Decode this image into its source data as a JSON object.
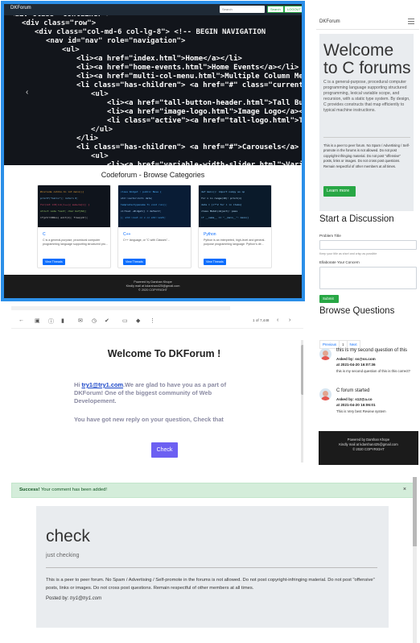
{
  "forum_window": {
    "brand": "DKForum",
    "search_placeholder": "Search",
    "search_button": "Search",
    "login_button": "LOGOUT",
    "section_title": "Codeforum - Browse Categories",
    "categories": [
      {
        "title": "C",
        "desc": "C is a general-purpose, procedural computer programming language supporting structured pro...",
        "button": "View Threads"
      },
      {
        "title": "C++",
        "desc": "C++ language, or \"C with Classes\"...",
        "button": "View Threads"
      },
      {
        "title": "Python",
        "desc": "Python is an interpreted, high-level and general-purpose programming language. Python's de...",
        "button": "View Threads"
      }
    ],
    "footer_line1": "Powered by Darshan Khope",
    "footer_line2": "Kindly mail at kdarshan425@gmail.com",
    "footer_line3": "© 2020 COPYRIGHT",
    "code_lines": [
      "<div class=\"container\">",
      "<div class=\"row\">",
      "<div class=\"col-md-6 col-lg-8\"> <!-- BEGIN NAVIGATION",
      "<nav id=\"nav\" role=\"navigation\">",
      "<ul>",
      "<li><a href=\"index.html\">Home</a></li>",
      "<li><a href=\"home-events.html\">Home Events</a></li>",
      "<li><a href=\"multi-col-menu.html\">Multiple Column Men",
      "<li class=\"has-children\"> <a href=\"#\" class=\"current\"",
      "<ul>",
      "<li><a href=\"tall-button-header.html\">Tall But",
      "<li><a href=\"image-logo.html\">Image Logo</a></",
      "<li class=\"active\"><a href=\"tall-logo.html\">T",
      "</ul>",
      "</li>",
      "<li class=\"has-children\"> <a href=\"#\">Carousels</a>",
      "<ul>",
      "<li><a href=\"variable-width-slider.html\">Variab",
      "<li><a href=\"testimonial-slider.html\">Testimonia"
    ]
  },
  "side_window": {
    "brand": "DKForum",
    "jumbo_title": "Welcome to C forums",
    "jumbo_lead": "C is a general-purpose, procedural computer programming language supporting structured programming, lexical variable scope, and recursion, with a static type system. By design, C provides constructs that map efficiently to typical machine instructions.",
    "jumbo_rules": "This is a peer to peer forum. No Spam / Advertising / Self-promote in the forums is not allowed. Do not post copyright-infringing material. Do not post \"offensive\" posts, links or images. Do not cross post questions. Remain respectful of other members at all times.",
    "learn_more": "Learn more",
    "start_title": "Start a Discussion",
    "problem_label": "Problem Title",
    "problem_hint": "Keep your title as short and crisp as possible",
    "concern_label": "Ellaborate Your Concern",
    "submit": "Submit",
    "browse_title": "Browse Questions",
    "pager": [
      "Previous",
      "1",
      "Next"
    ],
    "questions": [
      {
        "title": "this is my second question of this",
        "asked_prefix": "Asked by: ",
        "asked_by": "ss@ss.com",
        "asked_at": "at 2021-04-20 16:07:36",
        "desc": "this is my second question of this is this correct?"
      },
      {
        "title": "C forum started",
        "asked_prefix": "Asked by: ",
        "asked_by": "s12@a.co",
        "asked_at": "at 2021-04-20 16:06:01",
        "desc": "This is Very best Review system"
      }
    ],
    "footer_line1": "Powered by Darshan Khope",
    "footer_line2": "Kindly mail at kdarshan425@gmail.com",
    "footer_line3": "© 2020 COPYRIGHT"
  },
  "email": {
    "page_count": "1 of 7,448",
    "title": "Welcome To DKForum !",
    "greeting": "Hi ",
    "email_link": "try1@try1.com",
    "body_rest": ".We are glad to have you as a part of DKForum! One of the biggest community of Web Developement.",
    "body2": "You have got new reply on your question, Check that",
    "check_button": "Check"
  },
  "thread_page": {
    "alert_strong": "Success!",
    "alert_text": " Your comment has been added!",
    "alert_close": "×",
    "title": "check",
    "subtitle": "just checking",
    "rules": "This is a peer to peer forum. No Spam / Advertising / Self-promote in the forums is not allowed. Do not post copyright-infringing material. Do not post \"offensive\" posts, links or images. Do not cross post questions. Remain respectful of other members at all times.",
    "posted_label": "Posted by: ",
    "posted_by": "try1@try1.com"
  },
  "colors": {
    "accent_blue": "#2b8fe8",
    "success_green": "#28a745",
    "email_button": "#6c5ff2"
  }
}
